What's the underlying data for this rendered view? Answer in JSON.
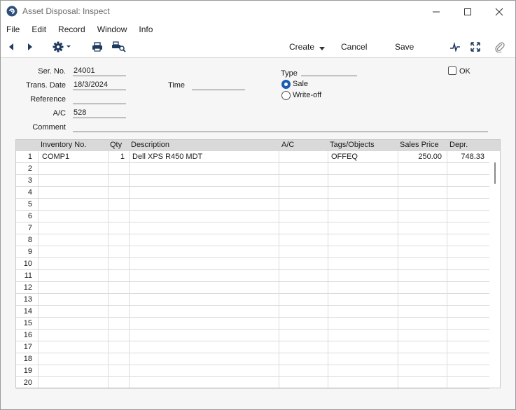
{
  "window": {
    "title": "Asset Disposal: Inspect"
  },
  "menu": [
    "File",
    "Edit",
    "Record",
    "Window",
    "Info"
  ],
  "toolbar": {
    "create_label": "Create",
    "cancel_label": "Cancel",
    "save_label": "Save",
    "icons": [
      "back-arrow-icon",
      "forward-arrow-icon",
      "gear-icon",
      "print-icon",
      "print-preview-icon",
      "pulse-icon",
      "expand-icon",
      "paperclip-icon"
    ]
  },
  "form": {
    "ser_no_label": "Ser. No.",
    "ser_no": "24001",
    "trans_date_label": "Trans. Date",
    "trans_date": "18/3/2024",
    "time_label": "Time",
    "time": "",
    "reference_label": "Reference",
    "reference": "",
    "ac_label": "A/C",
    "ac": "528",
    "comment_label": "Comment",
    "comment": "",
    "type_label": "Type",
    "type_options": [
      "Sale",
      "Write-off"
    ],
    "type_selected": "Sale",
    "ok_label": "OK",
    "ok_checked": false
  },
  "grid": {
    "columns": [
      "Inventory No.",
      "Qty",
      "Description",
      "A/C",
      "Tags/Objects",
      "Sales Price",
      "Depr."
    ],
    "rows": [
      [
        "1",
        "COMP1",
        "1",
        "Dell XPS R450 MDT",
        "",
        "OFFEQ",
        "250.00",
        "748.33"
      ],
      [
        "2",
        "",
        "",
        "",
        "",
        "",
        "",
        ""
      ],
      [
        "3",
        "",
        "",
        "",
        "",
        "",
        "",
        ""
      ],
      [
        "4",
        "",
        "",
        "",
        "",
        "",
        "",
        ""
      ],
      [
        "5",
        "",
        "",
        "",
        "",
        "",
        "",
        ""
      ],
      [
        "6",
        "",
        "",
        "",
        "",
        "",
        "",
        ""
      ],
      [
        "7",
        "",
        "",
        "",
        "",
        "",
        "",
        ""
      ],
      [
        "8",
        "",
        "",
        "",
        "",
        "",
        "",
        ""
      ],
      [
        "9",
        "",
        "",
        "",
        "",
        "",
        "",
        ""
      ],
      [
        "10",
        "",
        "",
        "",
        "",
        "",
        "",
        ""
      ],
      [
        "11",
        "",
        "",
        "",
        "",
        "",
        "",
        ""
      ],
      [
        "12",
        "",
        "",
        "",
        "",
        "",
        "",
        ""
      ],
      [
        "13",
        "",
        "",
        "",
        "",
        "",
        "",
        ""
      ],
      [
        "14",
        "",
        "",
        "",
        "",
        "",
        "",
        ""
      ],
      [
        "15",
        "",
        "",
        "",
        "",
        "",
        "",
        ""
      ],
      [
        "16",
        "",
        "",
        "",
        "",
        "",
        "",
        ""
      ],
      [
        "17",
        "",
        "",
        "",
        "",
        "",
        "",
        ""
      ],
      [
        "18",
        "",
        "",
        "",
        "",
        "",
        "",
        ""
      ],
      [
        "19",
        "",
        "",
        "",
        "",
        "",
        "",
        ""
      ],
      [
        "20",
        "",
        "",
        "",
        "",
        "",
        "",
        ""
      ]
    ]
  }
}
